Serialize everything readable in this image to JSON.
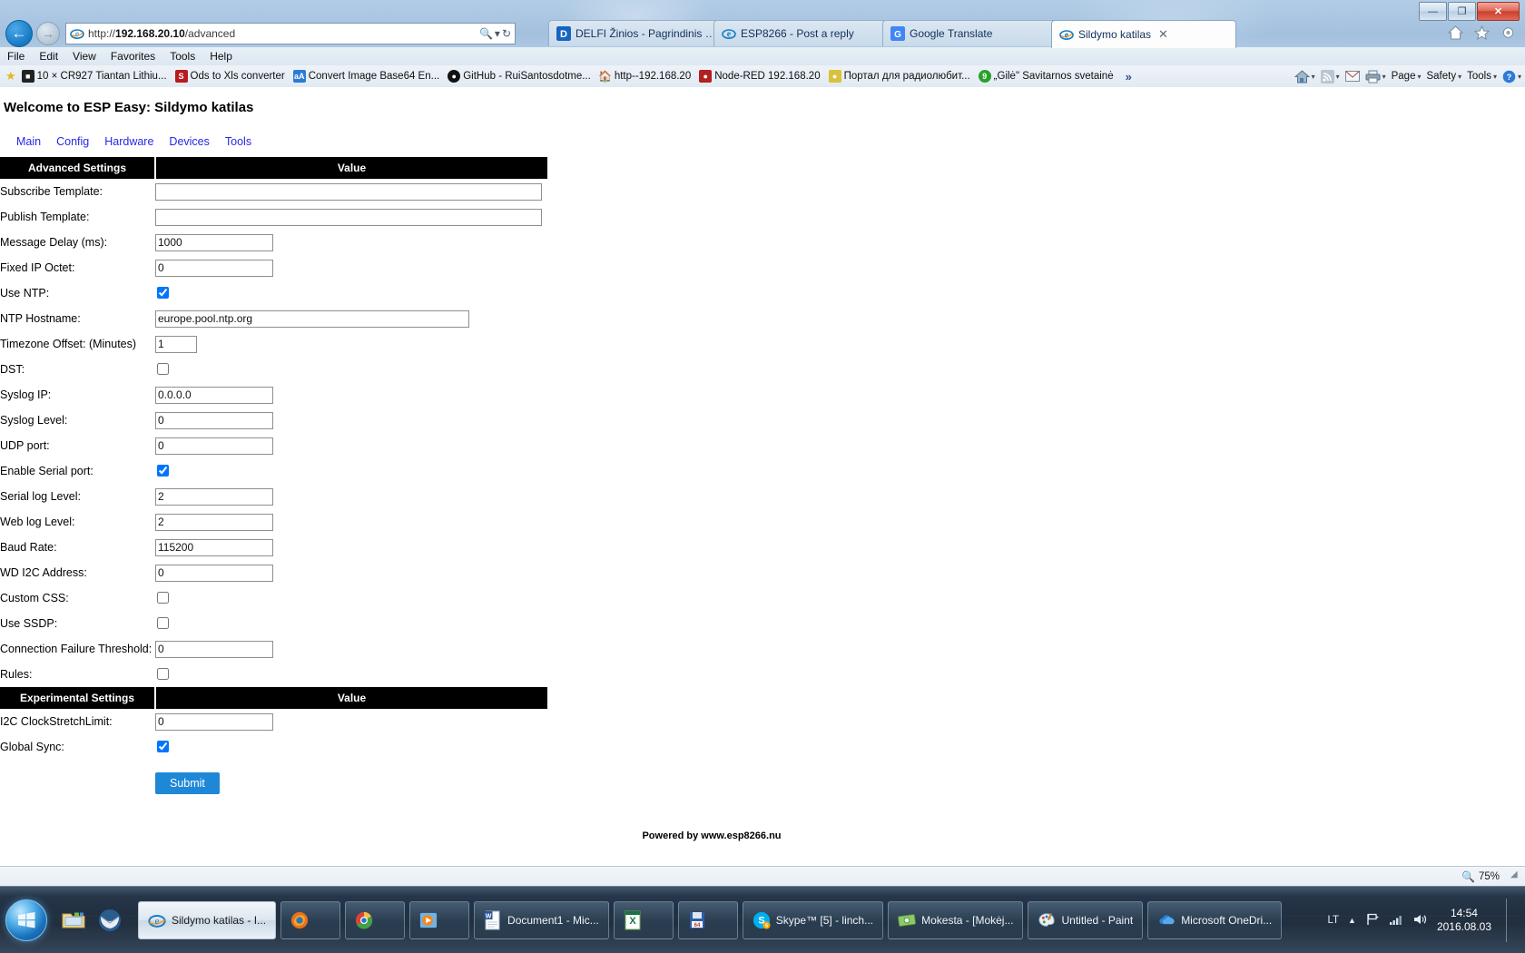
{
  "browser": {
    "window_buttons": {
      "minimize": "—",
      "maximize": "❐",
      "close": "✕"
    },
    "nav": {
      "back": "←",
      "forward": "→"
    },
    "address": {
      "url_prefix": "http://",
      "url_host": "192.168.20.10",
      "url_path": "/advanced",
      "full_url": "http://192.168.20.10/advanced",
      "search_icon": "search-icon",
      "dropdown_icon": "▾",
      "refresh_icon": "↻"
    },
    "tabs": [
      {
        "label": "DELFI Žinios - Pagrindinis nauji...",
        "favicon": "delfi-icon",
        "active": false
      },
      {
        "label": "ESP8266 - Post a reply",
        "favicon": "ie-icon",
        "active": false
      },
      {
        "label": "Google Translate",
        "favicon": "google-translate-icon",
        "active": false
      },
      {
        "label": "Sildymo katilas",
        "favicon": "ie-icon",
        "active": true,
        "close": "✕"
      }
    ],
    "menu": [
      "File",
      "Edit",
      "View",
      "Favorites",
      "Tools",
      "Help"
    ],
    "favorites": [
      {
        "label": "10 × CR927 Tiantan Lithiu...",
        "icon": "shop-icon"
      },
      {
        "label": "Ods to Xls converter",
        "icon": "s-icon"
      },
      {
        "label": "Convert Image Base64 En...",
        "icon": "aA-icon"
      },
      {
        "label": "GitHub - RuiSantosdotme...",
        "icon": "github-icon"
      },
      {
        "label": "http--192.168.20",
        "icon": "home-icon"
      },
      {
        "label": "Node-RED 192.168.20",
        "icon": "nodered-icon"
      },
      {
        "label": "Портал для радиолюбит...",
        "icon": "globe-icon"
      },
      {
        "label": "„Gilė\" Savitarnos svetainė",
        "icon": "gile-icon"
      },
      {
        "label": "»",
        "icon": "overflow-icon"
      }
    ],
    "command_bar": [
      {
        "label": "",
        "icon": "home-icon",
        "caret": "▾"
      },
      {
        "label": "",
        "icon": "feeds-icon",
        "caret": "▾"
      },
      {
        "label": "",
        "icon": "mail-icon",
        "caret": ""
      },
      {
        "label": "",
        "icon": "print-icon",
        "caret": "▾"
      },
      {
        "label": "Page",
        "icon": "",
        "caret": "▾"
      },
      {
        "label": "Safety",
        "icon": "",
        "caret": "▾"
      },
      {
        "label": "Tools",
        "icon": "",
        "caret": "▾"
      },
      {
        "label": "",
        "icon": "help-icon",
        "caret": "▾"
      }
    ],
    "toolbar_right_icons": [
      "home-icon",
      "favorites-star-icon",
      "gear-icon"
    ],
    "status": {
      "zoom": "75%",
      "zoom_icon": "magnifier-icon"
    }
  },
  "page": {
    "title": "Welcome to ESP Easy: Sildymo katilas",
    "nav": [
      "Main",
      "Config",
      "Hardware",
      "Devices",
      "Tools"
    ],
    "sections": [
      {
        "header_left": "Advanced Settings",
        "header_right": "Value",
        "rows": [
          {
            "label": "Subscribe Template:",
            "type": "text",
            "value": "",
            "size": "xl"
          },
          {
            "label": "Publish Template:",
            "type": "text",
            "value": "",
            "size": "xl"
          },
          {
            "label": "Message Delay (ms):",
            "type": "text",
            "value": "1000",
            "size": "m"
          },
          {
            "label": "Fixed IP Octet:",
            "type": "text",
            "value": "0",
            "size": "m"
          },
          {
            "label": "Use NTP:",
            "type": "checkbox",
            "checked": true
          },
          {
            "label": "NTP Hostname:",
            "type": "text",
            "value": "europe.pool.ntp.org",
            "size": "l"
          },
          {
            "label": "Timezone Offset: (Minutes)",
            "type": "text",
            "value": "1",
            "size": "s"
          },
          {
            "label": "DST:",
            "type": "checkbox",
            "checked": false
          },
          {
            "label": "Syslog IP:",
            "type": "text",
            "value": "0.0.0.0",
            "size": "m"
          },
          {
            "label": "Syslog Level:",
            "type": "text",
            "value": "0",
            "size": "m"
          },
          {
            "label": "UDP port:",
            "type": "text",
            "value": "0",
            "size": "m"
          },
          {
            "label": "Enable Serial port:",
            "type": "checkbox",
            "checked": true
          },
          {
            "label": "Serial log Level:",
            "type": "text",
            "value": "2",
            "size": "m"
          },
          {
            "label": "Web log Level:",
            "type": "text",
            "value": "2",
            "size": "m"
          },
          {
            "label": "Baud Rate:",
            "type": "text",
            "value": "115200",
            "size": "m"
          },
          {
            "label": "WD I2C Address:",
            "type": "text",
            "value": "0",
            "size": "m"
          },
          {
            "label": "Custom CSS:",
            "type": "checkbox",
            "checked": false
          },
          {
            "label": "Use SSDP:",
            "type": "checkbox",
            "checked": false
          },
          {
            "label": "Connection Failure Threshold:",
            "type": "text",
            "value": "0",
            "size": "m"
          },
          {
            "label": "Rules:",
            "type": "checkbox",
            "checked": false
          }
        ]
      },
      {
        "header_left": "Experimental Settings",
        "header_right": "Value",
        "rows": [
          {
            "label": "I2C ClockStretchLimit:",
            "type": "text",
            "value": "0",
            "size": "m"
          },
          {
            "label": "Global Sync:",
            "type": "checkbox",
            "checked": true
          }
        ]
      }
    ],
    "submit_label": "Submit",
    "footer": "Powered by www.esp8266.nu"
  },
  "taskbar": {
    "start": "start-orb",
    "quicklaunch": [
      {
        "icon": "explorer-folder-icon",
        "name": "windows-explorer"
      },
      {
        "icon": "thunderbird-icon",
        "name": "thunderbird"
      }
    ],
    "items": [
      {
        "label": "Sildymo katilas - I...",
        "icon": "ie-icon",
        "active": true
      },
      {
        "label": "",
        "icon": "firefox-icon",
        "active": false
      },
      {
        "label": "",
        "icon": "chrome-icon",
        "active": false
      },
      {
        "label": "",
        "icon": "media-player-icon",
        "active": false
      },
      {
        "label": "Document1 - Mic...",
        "icon": "word-icon",
        "active": false
      },
      {
        "label": "",
        "icon": "excel-icon",
        "active": false
      },
      {
        "label": "",
        "icon": "floppy64-icon",
        "active": false
      },
      {
        "label": "Skype™ [5] - linch...",
        "icon": "skype-icon",
        "active": false
      },
      {
        "label": "Mokesta - [Mokėj...",
        "icon": "money-icon",
        "active": false
      },
      {
        "label": "Untitled - Paint",
        "icon": "paint-icon",
        "active": false
      },
      {
        "label": "Microsoft OneDri...",
        "icon": "onedrive-icon",
        "active": false
      }
    ],
    "tray": {
      "language": "LT",
      "show_hidden": "▲",
      "icons": [
        "flag-icon",
        "network-icon",
        "volume-icon"
      ],
      "time": "14:54",
      "date": "2016.08.03"
    }
  },
  "colors": {
    "link": "#2727e8",
    "submit_bg": "#1e87d6",
    "header_bg": "#000000",
    "accent": "#1679c4"
  }
}
